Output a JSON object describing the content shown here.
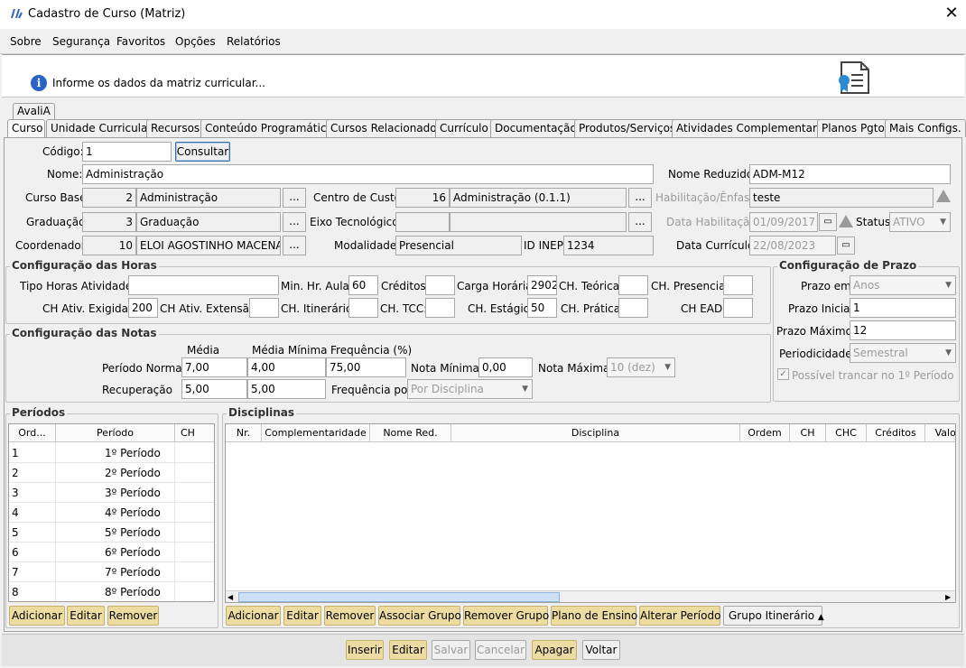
{
  "window": {
    "title": "Cadastro de Curso (Matriz)",
    "close": "✕"
  },
  "menu": [
    "Sobre",
    "Segurança",
    "Favoritos",
    "Opções",
    "Relatórios"
  ],
  "info": {
    "text": "Informe os dados da matriz curricular..."
  },
  "tabs_top": [
    "AvaliA"
  ],
  "tabs": [
    "Curso",
    "Unidade Curricular",
    "Recursos",
    "Conteúdo Programático",
    "Cursos Relacionados",
    "Currículo",
    "Documentação",
    "Produtos/Serviços",
    "Atividades Complementares",
    "Planos Pgto",
    "Mais Configs."
  ],
  "form": {
    "codigo_label": "Código:",
    "codigo": "1",
    "consultar": "Consultar",
    "nome_label": "Nome:",
    "nome": "Administração",
    "nome_reduzido_label": "Nome Reduzido:",
    "nome_reduzido": "ADM-M12",
    "curso_base_label": "Curso Base:",
    "curso_base_id": "2",
    "curso_base": "Administração",
    "centro_custo_label": "Centro de Custo:",
    "centro_custo_id": "16",
    "centro_custo": "Administração (0.1.1)",
    "habilitacao_label": "Habilitação/Ênfase:",
    "habilitacao": "teste",
    "graduacao_label": "Graduação:",
    "graduacao_id": "3",
    "graduacao": "Graduação",
    "eixo_label": "Eixo Tecnológico:",
    "eixo_id": "",
    "eixo": "",
    "data_hab_label": "Data Habilitação:",
    "data_hab": "01/09/2017",
    "status_label": "Status:",
    "status": "ATIVO",
    "coordenador_label": "Coordenador:",
    "coordenador_id": "10",
    "coordenador": "ELOI AGOSTINHO MACENA",
    "modalidade_label": "Modalidade:",
    "modalidade": "Presencial",
    "inep_label": "ID INEP:",
    "inep": "1234",
    "data_curr_label": "Data Currículo:",
    "data_curr": "22/08/2023",
    "dots": "..."
  },
  "horas": {
    "title": "Configuração das Horas",
    "tipo_label": "Tipo Horas Atividades:",
    "tipo": "",
    "min_hr_label": "Min. Hr. Aula:",
    "min_hr": "60",
    "creditos_label": "Créditos:",
    "creditos": "",
    "carga_label": "Carga Horária:",
    "carga": "2902",
    "ch_teorica_label": "CH. Teórica:",
    "ch_teorica": "",
    "ch_presencial_label": "CH. Presencial:",
    "ch_presencial": "",
    "ch_exig_label": "CH Ativ. Exigidas:",
    "ch_exig": "200",
    "ch_ext_label": "CH Ativ. Extensão:",
    "ch_ext": "",
    "ch_itin_label": "CH. Itinerário:",
    "ch_itin": "",
    "ch_tcc_label": "CH. TCC:",
    "ch_tcc": "",
    "ch_estagio_label": "CH. Estágio:",
    "ch_estagio": "50",
    "ch_pratica_label": "CH. Prática:",
    "ch_pratica": "",
    "ch_ead_label": "CH EAD:",
    "ch_ead": ""
  },
  "prazo": {
    "title": "Configuração de Prazo",
    "prazo_em_label": "Prazo em:",
    "prazo_em": "Anos",
    "inicial_label": "Prazo Inicial:",
    "inicial": "1",
    "maximo_label": "Prazo Máximo:",
    "maximo": "12",
    "periodicidade_label": "Periodicidade:",
    "periodicidade": "Semestral",
    "trancar": "Possível trancar no 1º Período"
  },
  "notas": {
    "title": "Configuração das Notas",
    "media_h": "Média",
    "media_min_h": "Média Mínima",
    "freq_h": "Frequência (%)",
    "periodo_label": "Período Normal",
    "media": "7,00",
    "media_min": "4,00",
    "freq": "75,00",
    "nota_min_label": "Nota Mínima",
    "nota_min": "0,00",
    "nota_max_label": "Nota Máxima",
    "nota_max": "10 (dez)",
    "recup_label": "Recuperação",
    "recup_media": "5,00",
    "recup_min": "5,00",
    "freq_por_label": "Frequência por:",
    "freq_por": "Por Disciplina"
  },
  "periodos": {
    "title": "Períodos",
    "columns": [
      "Ord...",
      "Período",
      "CH"
    ],
    "rows": [
      {
        "ord": "1",
        "periodo": "1º Período",
        "ch": ""
      },
      {
        "ord": "2",
        "periodo": "2º Período",
        "ch": ""
      },
      {
        "ord": "3",
        "periodo": "3º Período",
        "ch": ""
      },
      {
        "ord": "4",
        "periodo": "4º Período",
        "ch": ""
      },
      {
        "ord": "5",
        "periodo": "5º Período",
        "ch": ""
      },
      {
        "ord": "6",
        "periodo": "6º Período",
        "ch": ""
      },
      {
        "ord": "7",
        "periodo": "7º Período",
        "ch": ""
      },
      {
        "ord": "8",
        "periodo": "8º Período",
        "ch": ""
      }
    ],
    "buttons": [
      "Adicionar",
      "Editar",
      "Remover"
    ]
  },
  "disciplinas": {
    "title": "Disciplinas",
    "columns": [
      "Nr.",
      "Complementaridade",
      "Nome Red.",
      "Disciplina",
      "Ordem",
      "CH",
      "CHC",
      "Créditos",
      "Valor"
    ],
    "buttons": [
      "Adicionar",
      "Editar",
      "Remover",
      "Associar Grupo",
      "Remover Grupo",
      "Plano de Ensino",
      "Alterar Período",
      "Grupo Itinerário"
    ]
  },
  "bottom": [
    "Inserir",
    "Editar",
    "Salvar",
    "Cancelar",
    "Apagar",
    "Voltar"
  ],
  "icons": {
    "info": "i",
    "warning": "!",
    "calendar": "calendar-icon",
    "arrow_up": "▲",
    "arrow_down": "▼",
    "scroll_left": "◀",
    "scroll_right": "▶",
    "check": "✓"
  }
}
